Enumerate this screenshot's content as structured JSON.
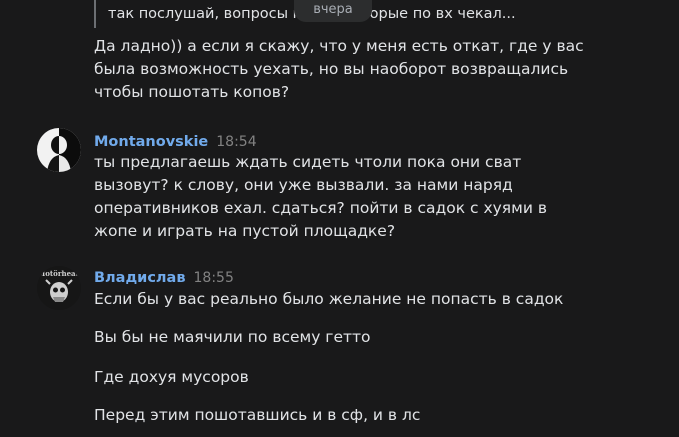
{
  "date_divider": "вчера",
  "messages": [
    {
      "quote": "так послушай, вопросы к тем, которые по вх чекал...",
      "text": "Да ладно)) а если я скажу, что у меня есть откат, где у вас была возможность уехать, но вы наоборот возвращались чтобы пошотать копов?"
    },
    {
      "author": "Montanovskie",
      "time": "18:54",
      "text": "ты предлагаешь ждать сидеть чтоли пока они сват вызовут? к слову, они уже вызвали. за нами наряд оперативников ехал. сдаться? пойти в садок с хуями в жопе и играть на пустой площадке?"
    },
    {
      "author": "Владислав",
      "time": "18:55",
      "avatar_label": "Motörhead",
      "lines": [
        "Если бы у вас реально было желание не попасть в садок",
        "Вы бы не маячили по всему гетто",
        "Где дохуя мусоров",
        "Перед этим пошотавшись и в сф, и в лс"
      ]
    }
  ]
}
